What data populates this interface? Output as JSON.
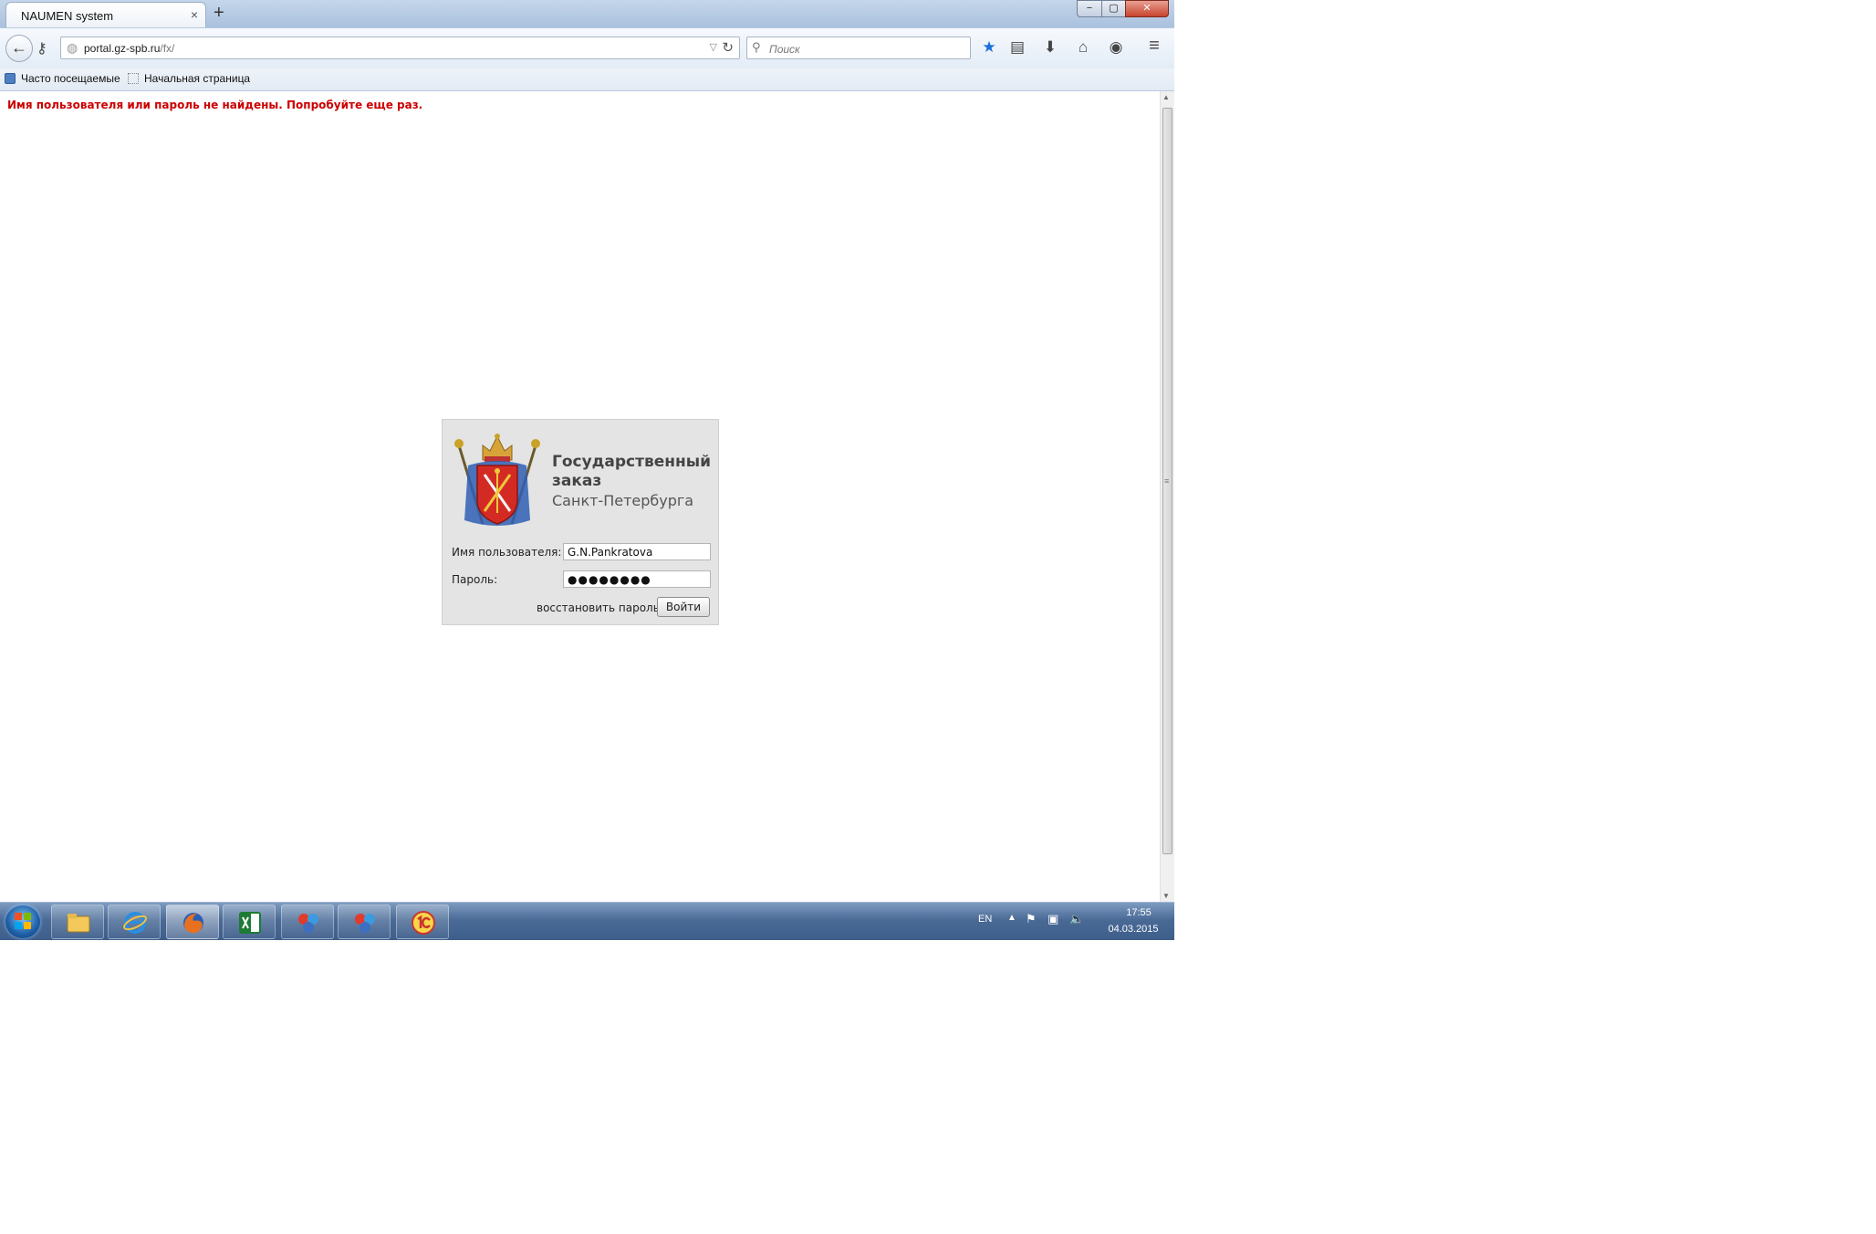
{
  "window": {
    "tab_title": "NAUMEN system",
    "tab_close": "×",
    "new_tab": "+",
    "min": "−",
    "max": "▢",
    "close": "✕"
  },
  "navbar": {
    "url_host": "portal.gz-spb.ru",
    "url_path": "/fx/",
    "search_placeholder": "Поиск"
  },
  "bookmarks": {
    "items": [
      {
        "label": "Часто посещаемые"
      },
      {
        "label": "Начальная страница"
      }
    ]
  },
  "page": {
    "error_message": "Имя пользователя или пароль не найдены. Попробуйте еще раз.",
    "brand": {
      "line1": "Государственный",
      "line2": "заказ",
      "line3": "Санкт-Петербурга"
    },
    "form": {
      "username_label": "Имя пользователя:",
      "username_value": "G.N.Pankratova",
      "password_label": "Пароль:",
      "password_value": "●●●●●●●●",
      "recover_label": "восстановить пароль",
      "login_label": "Войти"
    }
  },
  "taskbar": {
    "language": "EN",
    "time": "17:55",
    "date": "04.03.2015"
  },
  "colors": {
    "error": "#cc0000",
    "panel_bg": "#e4e4e4",
    "accent_star": "#1d6fd8"
  }
}
